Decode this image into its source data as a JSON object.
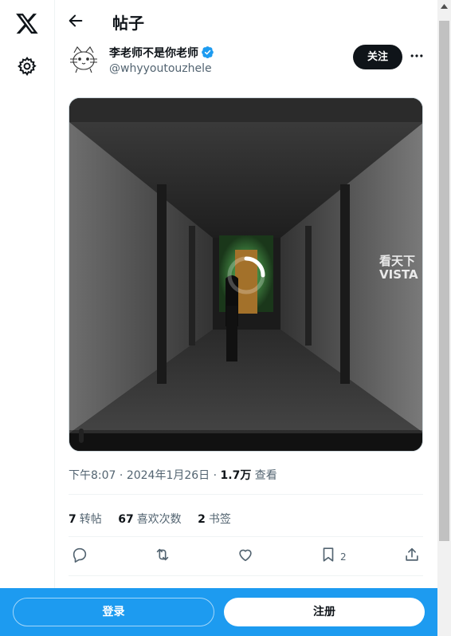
{
  "header": {
    "title": "帖子"
  },
  "author": {
    "name": "李老师不是你老师",
    "handle": "@whyyoutouzhele",
    "verified": true,
    "follow_label": "关注"
  },
  "media": {
    "type": "video",
    "watermark_line1": "看天下",
    "watermark_line2": "VISTA",
    "loading": true
  },
  "post": {
    "time": "下午8:07",
    "date": "2024年1月26日",
    "views_count": "1.7万",
    "views_label": "查看"
  },
  "stats": {
    "reposts_count": "7",
    "reposts_label": "转帖",
    "likes_count": "67",
    "likes_label": "喜欢次数",
    "bookmarks_count": "2",
    "bookmarks_label": "书签"
  },
  "actions": {
    "reply": "reply-icon",
    "repost": "repost-icon",
    "like": "heart-icon",
    "bookmark": "bookmark-icon",
    "bookmark_count": "2",
    "share": "share-icon"
  },
  "bottom_bar": {
    "login_label": "登录",
    "signup_label": "注册"
  },
  "colors": {
    "brand_blue": "#1d9bf0",
    "text": "#0f1419",
    "muted": "#536471"
  }
}
